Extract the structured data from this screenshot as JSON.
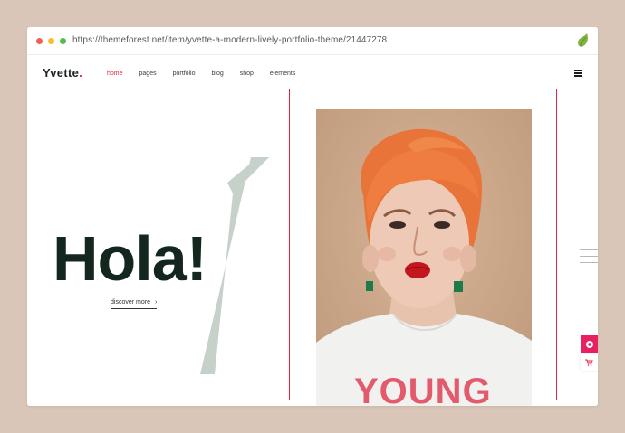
{
  "browser": {
    "url": "https://themeforest.net/item/yvette-a-modern-lively-portfolio-theme/21447278",
    "extension_icon": "envato-leaf-icon"
  },
  "site": {
    "logo_text": "Yvette",
    "logo_dot": ".",
    "nav": [
      {
        "label": "home",
        "active": true
      },
      {
        "label": "pages",
        "active": false
      },
      {
        "label": "portfolio",
        "active": false
      },
      {
        "label": "blog",
        "active": false
      },
      {
        "label": "shop",
        "active": false
      },
      {
        "label": "elements",
        "active": false
      }
    ],
    "hero": {
      "heading": "Hola!",
      "cta_label": "discover more",
      "cta_arrow": "›",
      "big_numeral_icon": "numeral-one-graphic",
      "photo_caption_text": "YOUNG"
    }
  },
  "colors": {
    "page_background": "#d9c6b8",
    "accent": "#e8203e",
    "heading": "#14271f",
    "numeral": "#c6d1ca",
    "photo_background": "#cba78a"
  }
}
